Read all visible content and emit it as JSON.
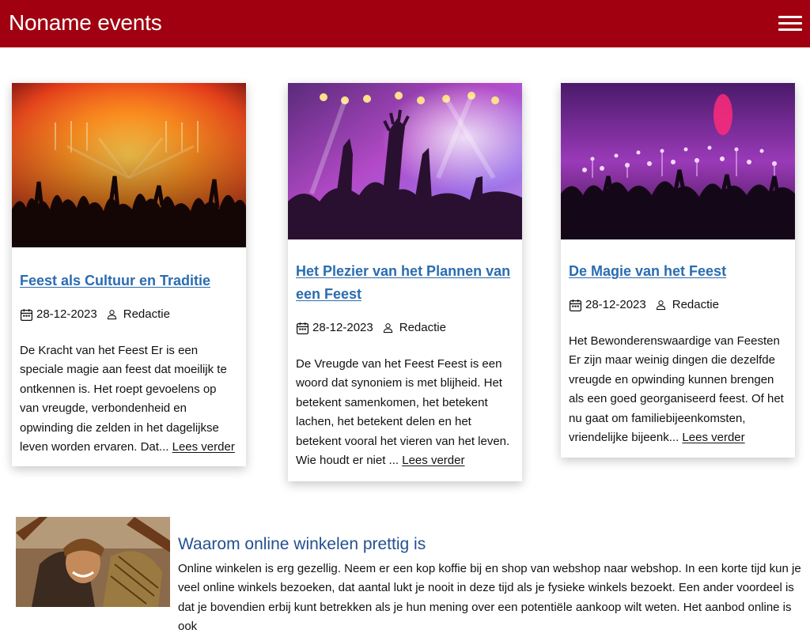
{
  "site": {
    "title": "Noname events",
    "menu_icon": "hamburger-menu-icon",
    "brand_color": "#a00010"
  },
  "posts": [
    {
      "title": "Feest als Cultuur en Traditie",
      "date": "28-12-2023",
      "author": "Redactie",
      "excerpt": "De Kracht van het Feest Er is een speciale magie aan feest dat moeilijk te ontkennen is. Het roept gevoelens op van vreugde, verbondenheid en opwinding die zelden in het dagelijkse leven worden ervaren. Dat...",
      "read_more": "Lees verder"
    },
    {
      "title": "Het Plezier van het Plannen van een Feest",
      "date": "28-12-2023",
      "author": "Redactie",
      "excerpt": "De Vreugde van het Feest Feest is een woord dat synoniem is met blijheid. Het betekent samenkomen, het betekent lachen, het betekent delen en het betekent vooral het vieren van het leven. Wie houdt er niet ...",
      "read_more": "Lees verder"
    },
    {
      "title": "De Magie van het Feest",
      "date": "28-12-2023",
      "author": "Redactie",
      "excerpt": "Het Bewonderenswaardige van Feesten Er zijn maar weinig dingen die dezelfde vreugde en opwinding kunnen brengen als een goed georganiseerd feest. Of het nu gaat om familiebijeenkomsten, vriendelijke bijeenk...",
      "read_more": "Lees verder"
    }
  ],
  "feature": {
    "title": "Waarom online winkelen prettig is",
    "text": "Online winkelen is erg gezellig. Neem er een kop koffie bij en shop van webshop naar webshop. In een korte tijd kun je veel online winkels bezoeken, dat aantal lukt je nooit in deze tijd als je fysieke winkels bezoekt. Een ander voordeel is dat je bovendien erbij kunt betrekken als je hun mening over een potentiële aankoop wilt weten. Het aanbod online is ook"
  },
  "colors": {
    "link": "#2b6cb0",
    "feature_title": "#24508f"
  }
}
